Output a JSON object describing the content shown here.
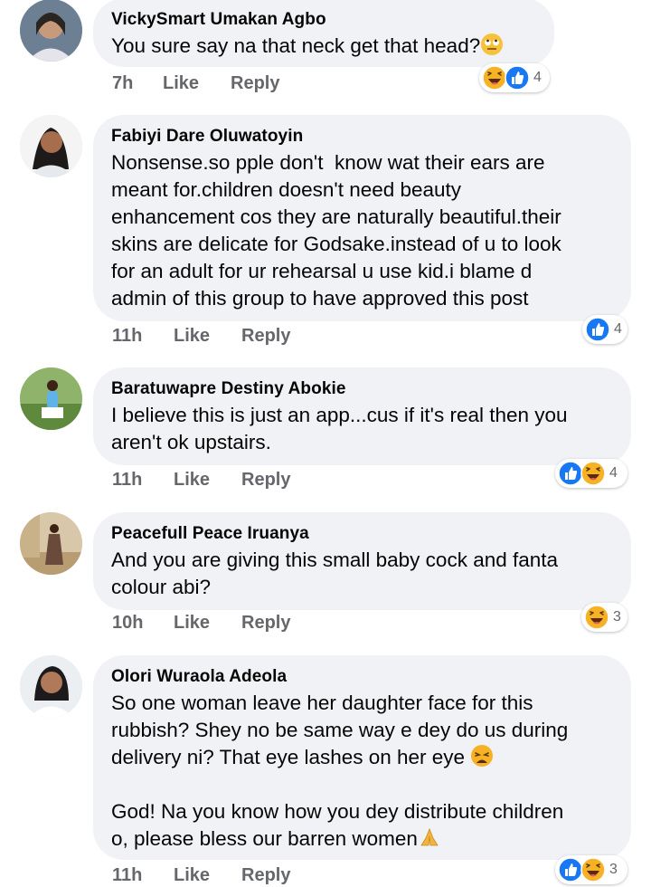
{
  "comments": [
    {
      "author": "VickySmart Umakan Agbo",
      "text": "You sure say na that neck get that head?",
      "emoji": "rolling-eyes-emoji",
      "time": "7h",
      "like": "Like",
      "reply": "Reply",
      "reactions": [
        "haha-reaction-icon",
        "like-reaction-icon"
      ],
      "count": "4"
    },
    {
      "author": "Fabiyi Dare Oluwatoyin",
      "text": "Nonsense.so pple don't  know wat their ears are\nmeant for.children doesn't need beauty\nenhancement cos they are naturally beautiful.their\nskins are delicate for Godsake.instead of u to look\nfor an adult for ur rehearsal u use kid.i blame d\nadmin of this group to have approved this post",
      "time": "11h",
      "like": "Like",
      "reply": "Reply",
      "reactions": [
        "like-reaction-icon"
      ],
      "count": "4"
    },
    {
      "author": "Baratuwapre Destiny Abokie",
      "text": "I believe this is just an app...cus if it's real then you\naren't ok upstairs.",
      "time": "11h",
      "like": "Like",
      "reply": "Reply",
      "reactions": [
        "like-reaction-icon",
        "haha-reaction-icon"
      ],
      "count": "4"
    },
    {
      "author": "Peacefull Peace Iruanya",
      "text": "And you are giving this small baby cock and fanta\ncolour abi?",
      "time": "10h",
      "like": "Like",
      "reply": "Reply",
      "reactions": [
        "haha-reaction-icon"
      ],
      "count": "3"
    },
    {
      "author": "Olori Wuraola Adeola",
      "text": "So one woman leave her daughter face for this\nrubbish? Shey no be same way e dey do us during\ndelivery ni? That eye lashes on her eye ",
      "text2": "\nGod! Na you know how you dey distribute children\no, please bless our barren women",
      "time": "11h",
      "like": "Like",
      "reply": "Reply",
      "reactions": [
        "like-reaction-icon",
        "haha-reaction-icon"
      ],
      "count": "3"
    }
  ],
  "colors": {
    "bubble": "#f0f2f5",
    "meta_text": "#65676b",
    "like_blue": "#1877f2",
    "haha_yellow": "#f7b125"
  }
}
